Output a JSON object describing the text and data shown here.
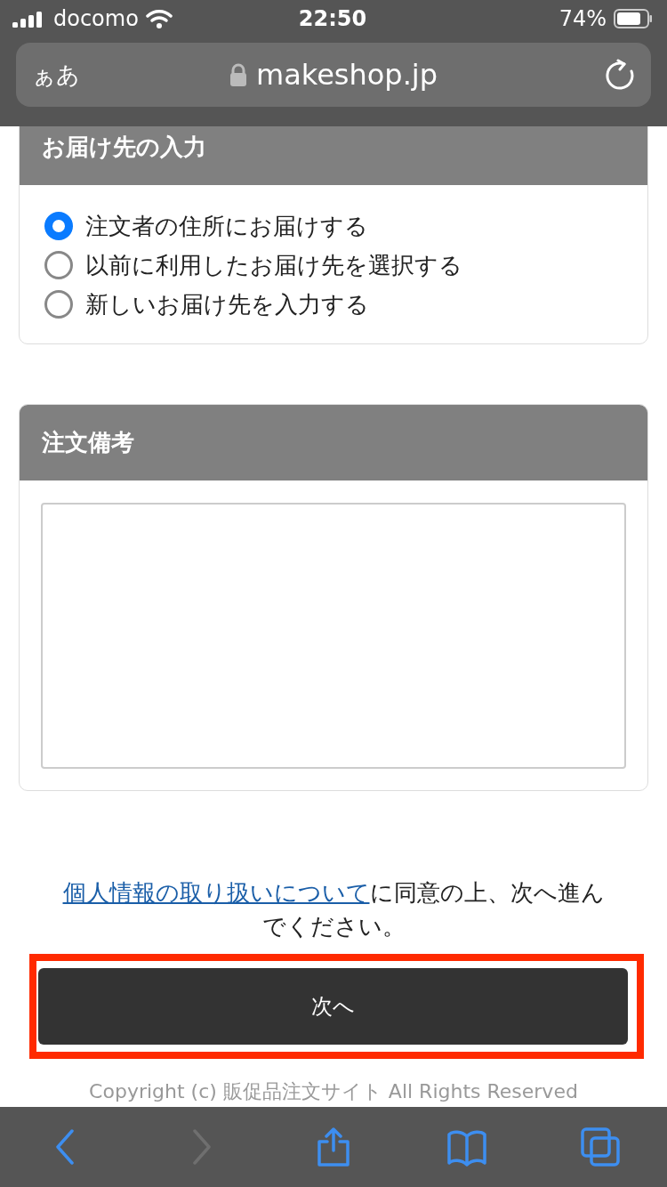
{
  "status_bar": {
    "carrier": "docomo",
    "time": "22:50",
    "battery": "74%"
  },
  "address_bar": {
    "text_size": "ぁあ",
    "url": "makeshop.jp"
  },
  "sections": [
    {
      "title": "お届け先の入力",
      "kind": "radio",
      "options": [
        {
          "label": "注文者の住所にお届けする",
          "selected": true
        },
        {
          "label": "以前に利用したお届け先を選択する",
          "selected": false
        },
        {
          "label": "新しいお届け先を入力する",
          "selected": false
        }
      ]
    },
    {
      "title": "注文備考",
      "kind": "textarea"
    }
  ],
  "notice": {
    "link": "個人情報の取り扱いについて",
    "text": "に同意の上、次へ進んでください。"
  },
  "next_button": {
    "label": "次へ",
    "highlighted": true
  },
  "copyright": "Copyright (c) 販促品注文サイト All Rights Reserved",
  "toolbar": [
    {
      "kind": "back",
      "disabled": false
    },
    {
      "kind": "forward",
      "disabled": true
    },
    {
      "kind": "share",
      "disabled": false
    },
    {
      "kind": "bookmarks",
      "disabled": false
    },
    {
      "kind": "tabs",
      "disabled": false
    }
  ]
}
